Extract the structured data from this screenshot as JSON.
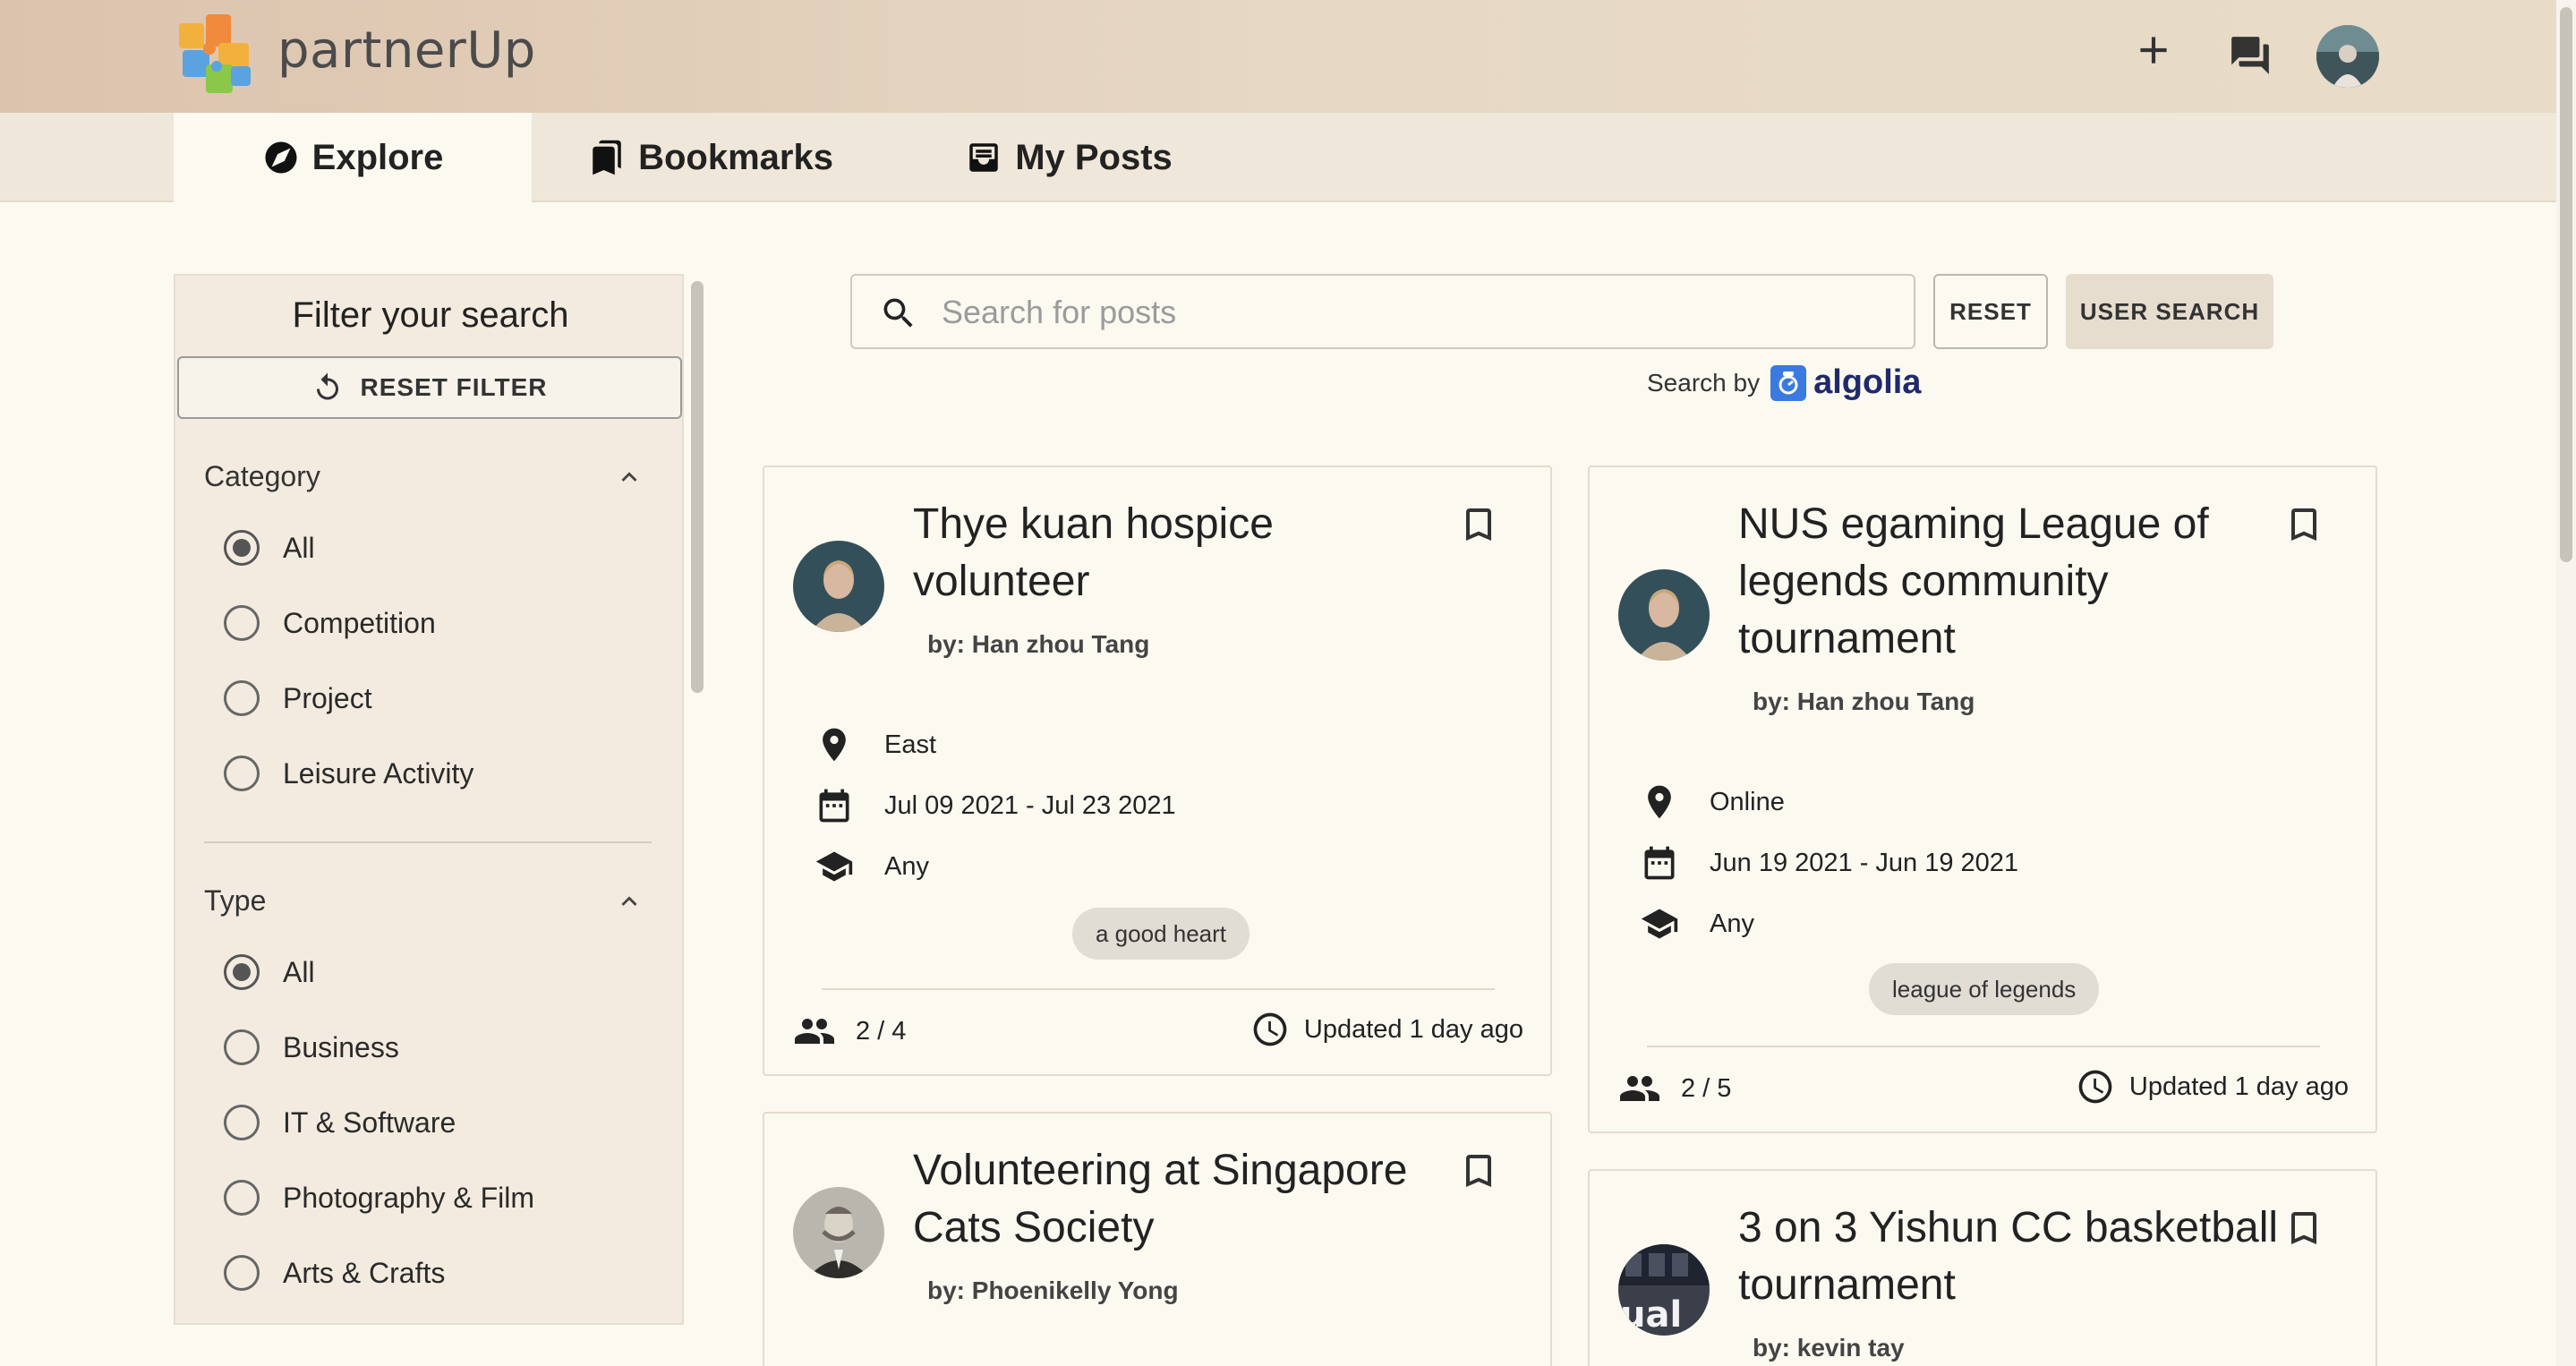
{
  "app": {
    "brand": "partnerUp"
  },
  "tabs": [
    {
      "label": "Explore",
      "icon": "compass-icon",
      "active": true
    },
    {
      "label": "Bookmarks",
      "icon": "bookmarks-icon",
      "active": false
    },
    {
      "label": "My Posts",
      "icon": "inbox-icon",
      "active": false
    }
  ],
  "filter": {
    "title": "Filter your search",
    "reset_label": "RESET FILTER",
    "category": {
      "heading": "Category",
      "options": [
        "All",
        "Competition",
        "Project",
        "Leisure Activity"
      ],
      "selected": "All"
    },
    "type": {
      "heading": "Type",
      "options": [
        "All",
        "Business",
        "IT & Software",
        "Photography & Film",
        "Arts & Crafts"
      ],
      "selected": "All"
    }
  },
  "search": {
    "placeholder": "Search for posts",
    "value": "",
    "reset_label": "RESET",
    "user_search_label": "USER SEARCH",
    "powered_by": "Search by",
    "powered_brand": "algolia"
  },
  "posts": [
    {
      "title": "Thye kuan hospice volunteer",
      "author": "by: Han zhou Tang",
      "location": "East",
      "dates": "Jul 09 2021 - Jul 23 2021",
      "education": "Any",
      "tag": "a good heart",
      "members": "2 / 4",
      "updated": "Updated 1 day ago"
    },
    {
      "title": "NUS egaming League of legends community tournament",
      "author": "by: Han zhou Tang",
      "location": "Online",
      "dates": "Jun 19 2021 - Jun 19 2021",
      "education": "Any",
      "tag": "league of legends",
      "members": "2 / 5",
      "updated": "Updated 1 day ago"
    },
    {
      "title": "Volunteering at Singapore Cats Society",
      "author": "by: Phoenikelly Yong"
    },
    {
      "title": "3 on 3 Yishun CC basketball tournament",
      "author": "by: kevin tay"
    }
  ]
}
